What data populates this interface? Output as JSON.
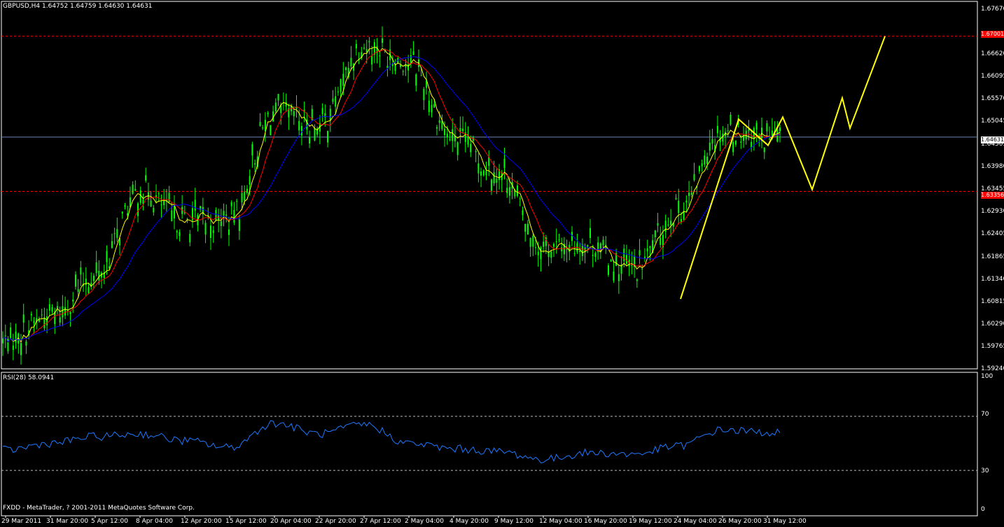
{
  "header": {
    "symbol_info": "GBPUSD,H4  1.64752 1.64759 1.64630 1.64631"
  },
  "rsi": {
    "title": "RSI(28) 58.0941",
    "levels": [
      "100",
      "70",
      "30",
      "0"
    ]
  },
  "footer": {
    "broker_text": "FXDD - MetaTrader, ? 2001-2011 MetaQuotes Software Corp."
  },
  "price_axis": {
    "labels": [
      "1.67670",
      "1.66620",
      "1.66095",
      "1.65570",
      "1.65045",
      "1.64505",
      "1.63980",
      "1.63455",
      "1.62930",
      "1.62405",
      "1.61865",
      "1.61340",
      "1.60815",
      "1.60290",
      "1.59765",
      "1.59240"
    ],
    "tags": {
      "upper_level": "1.67001",
      "current": "1.64631",
      "lower_level": "1.63356"
    }
  },
  "time_axis": {
    "labels": [
      "29 Mar 2011",
      "31 Mar 20:00",
      "5 Apr 12:00",
      "8 Apr 04:00",
      "12 Apr 20:00",
      "15 Apr 12:00",
      "20 Apr 04:00",
      "22 Apr 20:00",
      "27 Apr 12:00",
      "2 May 04:00",
      "4 May 20:00",
      "9 May 12:00",
      "12 May 04:00",
      "16 May 20:00",
      "19 May 12:00",
      "24 May 04:00",
      "26 May 20:00",
      "31 May 12:00"
    ]
  },
  "colors": {
    "background": "#000000",
    "candles": "#00ff00",
    "ma_fast": "#ffff00",
    "ma_mid": "#ff0000",
    "ma_slow": "#0000ff",
    "forecast": "#ffff00",
    "rsi_line": "#1e78ff",
    "level_dashed": "#ff0000",
    "current_line": "#6b86b8",
    "grid_border": "#ffffff"
  },
  "chart_data": {
    "type": "line",
    "title": "GBPUSD,H4",
    "xlabel": "",
    "ylabel": "",
    "ylim": [
      1.5924,
      1.6767
    ],
    "x": [
      "29 Mar 2011",
      "31 Mar 20:00",
      "5 Apr 12:00",
      "8 Apr 04:00",
      "12 Apr 20:00",
      "15 Apr 12:00",
      "20 Apr 04:00",
      "22 Apr 20:00",
      "27 Apr 12:00",
      "2 May 04:00",
      "4 May 20:00",
      "9 May 12:00",
      "12 May 04:00",
      "16 May 20:00",
      "19 May 12:00",
      "24 May 04:00",
      "26 May 20:00",
      "31 May 12:00"
    ],
    "series": [
      {
        "name": "GBPUSD,H4",
        "values": [
          1.5985,
          1.6045,
          1.6135,
          1.6335,
          1.6265,
          1.627,
          1.652,
          1.649,
          1.668,
          1.664,
          1.646,
          1.638,
          1.62,
          1.621,
          1.615,
          1.629,
          1.648,
          1.6463
        ]
      },
      {
        "name": "RSI(28)",
        "values": [
          45,
          50,
          55,
          57,
          52,
          47,
          65,
          57,
          64,
          50,
          46,
          44,
          38,
          43,
          42,
          48,
          60,
          58
        ]
      }
    ],
    "levels": [
      1.67001,
      1.63356
    ],
    "current": 1.64631,
    "rsi_levels": [
      70,
      30
    ],
    "forecast": [
      1.6083,
      1.6505,
      1.6444,
      1.651,
      1.634,
      1.6555,
      1.6484,
      1.67
    ]
  }
}
